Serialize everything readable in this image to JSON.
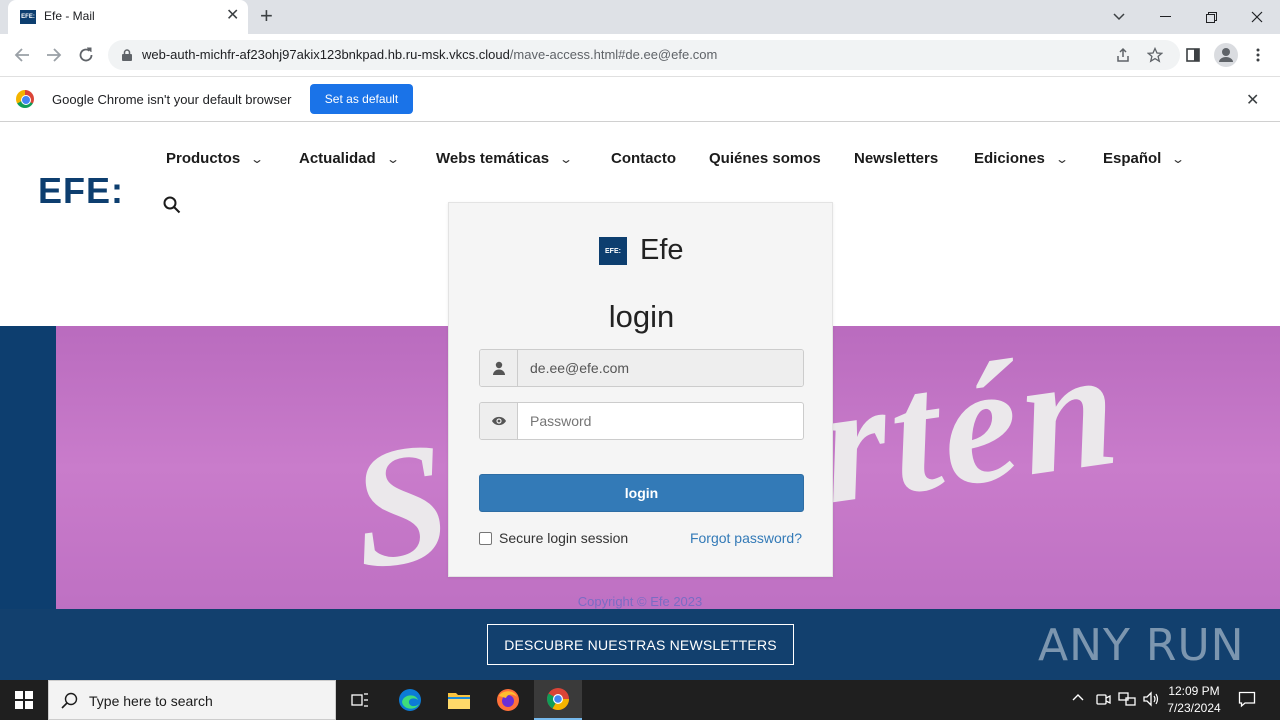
{
  "browser": {
    "tab_title": "Efe - Mail",
    "tab_favicon_text": "EFE:",
    "url_host": "web-auth-michfr-af23ohj97akix123bnkpad.hb.ru-msk.vkcs.cloud",
    "url_path": "/mave-access.html#de.ee@efe.com",
    "infobar_text": "Google Chrome isn't your default browser",
    "set_default_label": "Set as default"
  },
  "site": {
    "logo_text": "EFE:",
    "nav": [
      "Productos",
      "Actualidad",
      "Webs temáticas",
      "Contacto",
      "Quiénes somos",
      "Newsletters",
      "Ediciones",
      "Español"
    ],
    "hero_text": "Sal Sartén",
    "newsletter_button": "DESCUBRE NUESTRAS NEWSLETTERS",
    "copyright": "Copyright © Efe 2023",
    "watermark": "ANY RUN"
  },
  "login": {
    "logo_text": "EFE:",
    "brand": "Efe",
    "heading": "login",
    "email_value": "de.ee@efe.com",
    "password_placeholder": "Password",
    "submit_label": "login",
    "secure_label": "Secure login session",
    "forgot_label": "Forgot password?"
  },
  "taskbar": {
    "search_placeholder": "Type here to search",
    "time": "12:09 PM",
    "date": "7/23/2024"
  },
  "colors": {
    "efe_blue": "#0d3e6f",
    "hero_pink": "#c77ac9",
    "button_blue": "#337ab7",
    "chrome_blue": "#1a73e8"
  }
}
